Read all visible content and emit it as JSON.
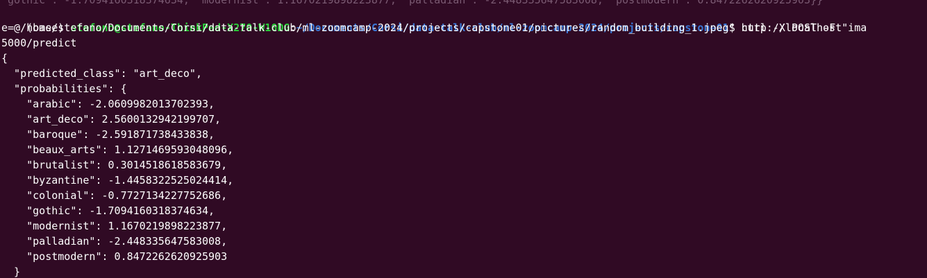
{
  "terminal": {
    "colors": {
      "background": "#300a24",
      "foreground": "#ffffff",
      "user_host": "#2ad039",
      "path": "#3b77d6"
    },
    "top_partial_line": "\"gothic\": -1.7094160318374634, \"modernist\": 1.1670219898223877, \"palladian\": -2.448335647583008, \"postmodern\": 0.8472262620925903}}",
    "prompt": {
      "env": "(base) ",
      "user_host": "stefano@stefano-ThinkPad-X270-W10DG",
      "separator": ":",
      "cwd": "~/Documents/Corsi/data-talk-club/ml-zoomcamp-2024/projects/capstone01",
      "symbol": "$ ",
      "command_start": "curl -X POST -F \"ima"
    },
    "command_continued": [
      "e=@/home/stefano/Documents/Corsi/data-talk-club/ml-zoomcamp-2024/projects/capstone01/pictures/random_building_1.jpeg\" http://localhost",
      "5000/predict"
    ],
    "output": [
      "{",
      "  \"predicted_class\": \"art_deco\",",
      "  \"probabilities\": {",
      "    \"arabic\": -2.0609982013702393,",
      "    \"art_deco\": 2.5600132942199707,",
      "    \"baroque\": -2.591871738433838,",
      "    \"beaux_arts\": 1.1271469593048096,",
      "    \"brutalist\": 0.3014518618583679,",
      "    \"byzantine\": -1.4458322525024414,",
      "    \"colonial\": -0.7727134227752686,",
      "    \"gothic\": -1.7094160318374634,",
      "    \"modernist\": 1.1670219898223877,",
      "    \"palladian\": -2.448335647583008,",
      "    \"postmodern\": 0.8472262620925903",
      "  }"
    ]
  }
}
